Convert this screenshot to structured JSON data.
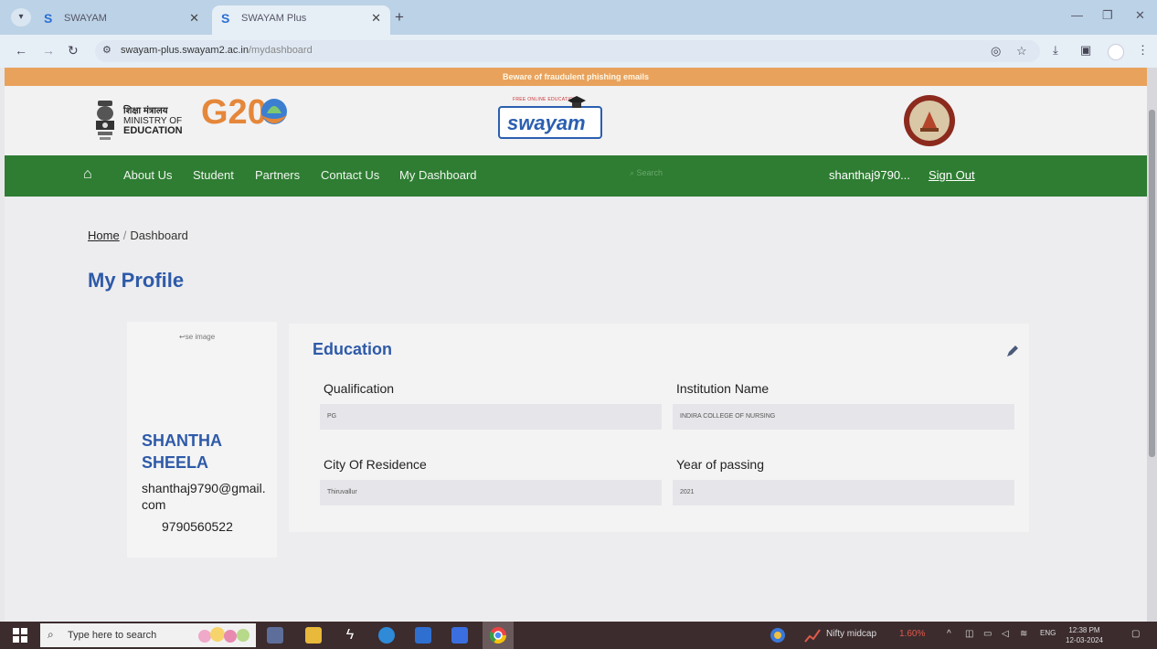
{
  "browser": {
    "tabs": [
      {
        "label": "SWAYAM",
        "active": false
      },
      {
        "label": "SWAYAM Plus",
        "active": true
      }
    ],
    "url_host": "swayam-plus.swayam2.ac.in",
    "url_path": "/mydashboard"
  },
  "banner": {
    "text": "Beware of fraudulent phishing emails"
  },
  "header": {
    "moe_hindi": "शिक्षा मंत्रालय",
    "moe_line1": "MINISTRY OF",
    "moe_line2": "EDUCATION",
    "g20": "G20",
    "swayam": "swayam"
  },
  "nav": {
    "items": [
      "About Us",
      "Student",
      "Partners",
      "Contact Us",
      "My Dashboard"
    ],
    "search_placeholder": "Search",
    "user": "shanthaj9790...",
    "signout": "Sign Out"
  },
  "breadcrumb": {
    "home": "Home",
    "current": "Dashboard"
  },
  "profile": {
    "title": "My Profile",
    "image_alt": "se image",
    "name": "SHANTHA SHEELA",
    "email": "shanthaj9790@gmail.com",
    "phone": "9790560522"
  },
  "education": {
    "title": "Education",
    "fields": [
      {
        "label": "Qualification",
        "value": "PG"
      },
      {
        "label": "Institution Name",
        "value": "INDIRA COLLEGE OF NURSING"
      },
      {
        "label": "City Of Residence",
        "value": "Thiruvallur"
      },
      {
        "label": "Year of passing",
        "value": "2021"
      }
    ]
  },
  "taskbar": {
    "search_placeholder": "Type here to search",
    "ticker_name": "Nifty midcap",
    "ticker_value": "1.60%",
    "lang": "ENG",
    "time": "12:38 PM",
    "date": "12-03-2024"
  },
  "colors": {
    "accent_blue": "#2e5aa8",
    "nav_green": "#2e7d32",
    "banner_orange": "#e8a25c",
    "ticker_red": "#e05a4a"
  }
}
